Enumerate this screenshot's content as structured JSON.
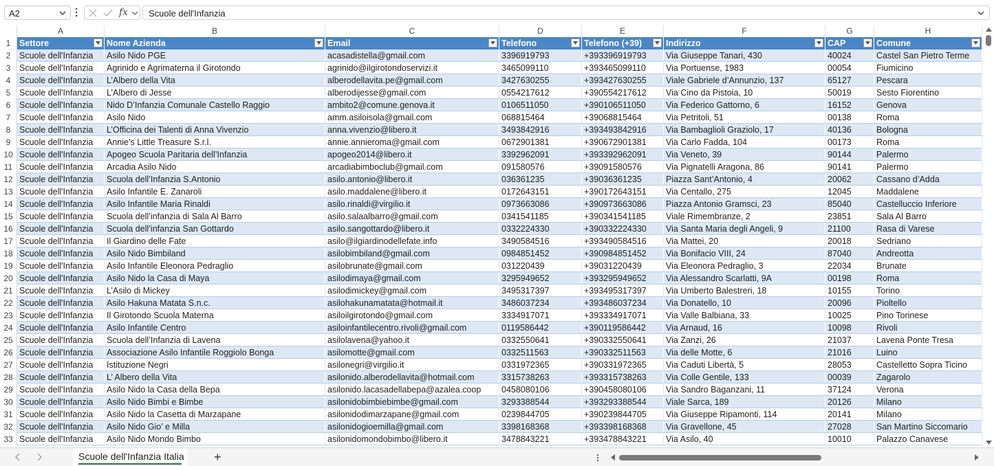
{
  "formula_bar": {
    "name_box": "A2",
    "formula": "Scuole dell'Infanzia",
    "fx_label": "fx"
  },
  "columns": [
    "A",
    "B",
    "C",
    "D",
    "E",
    "F",
    "G",
    "H"
  ],
  "headers": [
    "Settore",
    "Nome Azienda",
    "Email",
    "Telefono",
    "Telefono (+39)",
    "Indirizzo",
    "CAP",
    "Comune"
  ],
  "rows": [
    {
      "n": "2",
      "c": [
        "Scuole dell'Infanzia",
        "Asilo Nido PGE",
        "acasadistella@gmail.com",
        "3396919793",
        "+393396919793",
        "Via Giuseppe Tanari, 430",
        "40024",
        "Castel San Pietro Terme"
      ]
    },
    {
      "n": "3",
      "c": [
        "Scuole dell'Infanzia",
        "Agrinido e Agrimaterna il Girotondo",
        "agrinido@ilgirotondoservizi.it",
        "3465099110",
        "+393465099110",
        "Via Portuense, 1983",
        "00054",
        "Fiumicino"
      ]
    },
    {
      "n": "4",
      "c": [
        "Scuole dell'Infanzia",
        "L’Albero della Vita",
        "alberodellavita.pe@gmail.com",
        "3427630255",
        "+393427630255",
        "Viale Gabriele d’Annunzio, 137",
        "65127",
        "Pescara"
      ]
    },
    {
      "n": "5",
      "c": [
        "Scuole dell'Infanzia",
        "L’Albero di Jesse",
        "alberodijesse@gmail.com",
        "0554217612",
        "+390554217612",
        "Via Cino da Pistoia, 10",
        "50019",
        "Sesto Fiorentino"
      ]
    },
    {
      "n": "6",
      "c": [
        "Scuole dell'Infanzia",
        "Nido D’Infanzia Comunale Castello Raggio",
        "ambito2@comune.genova.it",
        "0106511050",
        "+390106511050",
        "Via Federico Gattorno, 6",
        "16152",
        "Genova"
      ]
    },
    {
      "n": "7",
      "c": [
        "Scuole dell'Infanzia",
        "Asilo Nido",
        "amm.asiloisola@gmail.com",
        "068815464",
        "+39068815464",
        "Via Petritoli, 51",
        "00138",
        "Roma"
      ]
    },
    {
      "n": "8",
      "c": [
        "Scuole dell'Infanzia",
        "L’Officina dei Talenti di Anna Vivenzio",
        "anna.vivenzio@libero.it",
        "3493842916",
        "+393493842916",
        "Via Bambaglioli Graziolo, 17",
        "40136",
        "Bologna"
      ]
    },
    {
      "n": "9",
      "c": [
        "Scuole dell'Infanzia",
        "Annie’s Little Treasure S.r.l.",
        "annie.annieroma@gmail.com",
        "0672901381",
        "+390672901381",
        "Via Carlo Fadda, 104",
        "00173",
        "Roma"
      ]
    },
    {
      "n": "10",
      "c": [
        "Scuole dell'Infanzia",
        "Apogeo Scuola Paritaria dell’Infanzia",
        "apogeo2014@libero.it",
        "3392962091",
        "+393392962091",
        "Via Veneto, 39",
        "90144",
        "Palermo"
      ]
    },
    {
      "n": "11",
      "c": [
        "Scuole dell'Infanzia",
        "Arcadia Asilo Nido",
        "arcadiabimboclub@gmail.com",
        "091580576",
        "+39091580576",
        "Via Pignatelli Aragona, 86",
        "90141",
        "Palermo"
      ]
    },
    {
      "n": "12",
      "c": [
        "Scuole dell'Infanzia",
        "Scuola dell’Infanzia S.Antonio",
        "asilo.antonio@libero.it",
        "036361235",
        "+39036361235",
        "Piazza Sant’Antonio, 4",
        "20062",
        "Cassano d’Adda"
      ]
    },
    {
      "n": "13",
      "c": [
        "Scuole dell'Infanzia",
        "Asilo Infantile E. Zanaroli",
        "asilo.maddalene@libero.it",
        "0172643151",
        "+390172643151",
        "Via Centallo, 275",
        "12045",
        "Maddalene"
      ]
    },
    {
      "n": "14",
      "c": [
        "Scuole dell'Infanzia",
        "Asilo Infantile Maria Rinaldi",
        "asilo.rinaldi@virgilio.it",
        "0973663086",
        "+390973663086",
        "Piazza Antonio Gramsci, 23",
        "85040",
        "Castelluccio Inferiore"
      ]
    },
    {
      "n": "15",
      "c": [
        "Scuole dell'Infanzia",
        "Scuola dell’infanzia di Sala Al Barro",
        "asilo.salaalbarro@gmail.com",
        "0341541185",
        "+390341541185",
        "Viale Rimembranze, 2",
        "23851",
        "Sala Al Barro"
      ]
    },
    {
      "n": "16",
      "c": [
        "Scuole dell'Infanzia",
        "Scuola dell’infanzia San Gottardo",
        "asilo.sangottardo@libero.it",
        "0332224330",
        "+390332224330",
        "Via Santa Maria degli Angeli, 9",
        "21100",
        "Rasa di Varese"
      ]
    },
    {
      "n": "17",
      "c": [
        "Scuole dell'Infanzia",
        "Il Giardino delle Fate",
        "asilo@ilgiardinodellefate.info",
        "3490584516",
        "+393490584516",
        "Via Mattei, 20",
        "20018",
        "Sedriano"
      ]
    },
    {
      "n": "18",
      "c": [
        "Scuole dell'Infanzia",
        "Asilo Nido Bimbiland",
        "asilobimbiland@gmail.com",
        "0984851452",
        "+390984851452",
        "Via Bonifacio VIII, 24",
        "87040",
        "Andreotta"
      ]
    },
    {
      "n": "19",
      "c": [
        "Scuole dell'Infanzia",
        "Asilo Infantile Eleonora Pedraglio",
        "asilobrunate@gmail.com",
        "031220439",
        "+39031220439",
        "Via Eleonora Pedraglio, 3",
        "22034",
        "Brunate"
      ]
    },
    {
      "n": "20",
      "c": [
        "Scuole dell'Infanzia",
        "Asilo Nido la Casa di Maya",
        "asilodimaya@gmail.com",
        "3295949652",
        "+393295949652",
        "Via Alessandro Scarlatti, 9A",
        "00198",
        "Roma"
      ]
    },
    {
      "n": "21",
      "c": [
        "Scuole dell'Infanzia",
        "L’Asilo di Mickey",
        "asilodimickey@gmail.com",
        "3495317397",
        "+393495317397",
        "Via Umberto Balestreri, 18",
        "10155",
        "Torino"
      ]
    },
    {
      "n": "22",
      "c": [
        "Scuole dell'Infanzia",
        "Asilo Hakuna Matata S.n.c.",
        "asilohakunamatata@hotmail.it",
        "3486037234",
        "+393486037234",
        "Via Donatello, 10",
        "20096",
        "Pioltello"
      ]
    },
    {
      "n": "23",
      "c": [
        "Scuole dell'Infanzia",
        "Il Girotondo Scuola Materna",
        "asiloilgirotondo@gmail.com",
        "3334917071",
        "+393334917071",
        "Via Valle Balbiana, 33",
        "10025",
        "Pino Torinese"
      ]
    },
    {
      "n": "24",
      "c": [
        "Scuole dell'Infanzia",
        "Asilo Infantile Centro",
        "asiloinfantilecentro.rivoli@gmail.com",
        "0119586442",
        "+390119586442",
        "Via Arnaud, 16",
        "10098",
        "Rivoli"
      ]
    },
    {
      "n": "25",
      "c": [
        "Scuole dell'Infanzia",
        "Scuola dell’Infanzia di Lavena",
        "asilolavena@yahoo.it",
        "0332550641",
        "+390332550641",
        "Via Zanzi, 26",
        "21037",
        "Lavena Ponte Tresa"
      ]
    },
    {
      "n": "26",
      "c": [
        "Scuole dell'Infanzia",
        "Associazione Asilo Infantile Roggiolo Bonga",
        "asilomotte@gmail.com",
        "0332511563",
        "+390332511563",
        "Via delle Motte, 6",
        "21016",
        "Luino"
      ]
    },
    {
      "n": "27",
      "c": [
        "Scuole dell'Infanzia",
        "Istituzione Negri",
        "asilonegri@virgilio.it",
        "0331972365",
        "+390331972365",
        "Via Caduti Libertà, 5",
        "28053",
        "Castelletto Sopra Ticino"
      ]
    },
    {
      "n": "28",
      "c": [
        "Scuole dell'Infanzia",
        "L’ Albero della Vita",
        "asilonido.alberodellavita@hotmail.com",
        "3315738263",
        "+393315738263",
        "Via Colle Gentile, 133",
        "00039",
        "Zagarolo"
      ]
    },
    {
      "n": "29",
      "c": [
        "Scuole dell'Infanzia",
        "Asilo Nido la Casa della Bepa",
        "asilonido.lacasadellabepa@azalea.coop",
        "0458080106",
        "+390458080106",
        "Via Sandro Baganzani, 11",
        "37124",
        "Verona"
      ]
    },
    {
      "n": "30",
      "c": [
        "Scuole dell'Infanzia",
        "Asilo Nido Bimbi e Bimbe",
        "asilonidobimbiebimbe@gmail.com",
        "3293388544",
        "+393293388544",
        "Viale Sarca, 189",
        "20126",
        "Milano"
      ]
    },
    {
      "n": "31",
      "c": [
        "Scuole dell'Infanzia",
        "Asilo Nido la Casetta di Marzapane",
        "asilonidodimarzapane@gmail.com",
        "0239844705",
        "+390239844705",
        "Via Giuseppe Ripamonti, 114",
        "20141",
        "Milano"
      ]
    },
    {
      "n": "32",
      "c": [
        "Scuole dell'Infanzia",
        "Asilo Nido Gio’ e Milla",
        "asilonidogioemilla@gmail.com",
        "3398168368",
        "+393398168368",
        "Via Gravellone, 45",
        "27028",
        "San Martino Siccomario"
      ]
    },
    {
      "n": "33",
      "c": [
        "Scuole dell'Infanzia",
        "Asilo Nido Mondo Bimbo",
        "asilonidomondobimbo@libero.it",
        "3478843221",
        "+393478843221",
        "Via Asilo, 40",
        "10010",
        "Palazzo Canavese"
      ]
    }
  ],
  "sheet_tabs": {
    "active": "Scuole dell'Infanzia Italia",
    "add_label": "+"
  },
  "colors": {
    "header_fill": "#4a86c8",
    "band_fill": "#dde8f4",
    "active_tab_underline": "#217346"
  }
}
